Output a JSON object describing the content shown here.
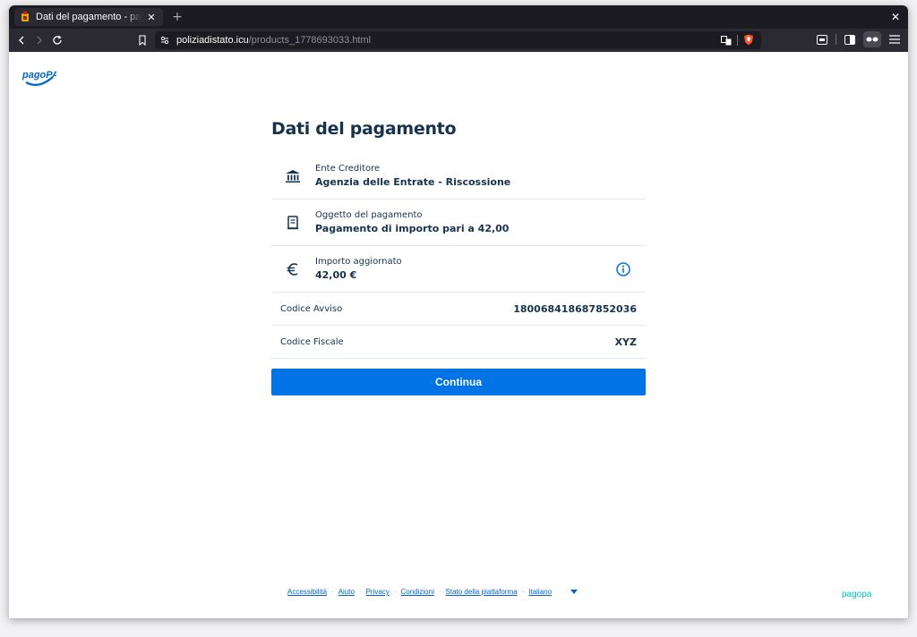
{
  "browser": {
    "tab_title": "Dati del pagamento - pagoPA",
    "url_domain": "poliziadistato.icu",
    "url_path": "/products_1778693033.html"
  },
  "page": {
    "logo_text": "pagoPA",
    "title": "Dati del pagamento",
    "items": [
      {
        "label": "Ente Creditore",
        "value": "Agenzia delle Entrate - Riscossione",
        "icon": "bank-icon"
      },
      {
        "label": "Oggetto del pagamento",
        "value": "Pagamento di importo pari a 42,00",
        "icon": "receipt-icon"
      },
      {
        "label": "Importo aggiornato",
        "value": "42,00 €",
        "icon": "euro-icon"
      }
    ],
    "details": [
      {
        "label": "Codice Avviso",
        "value": "180068418687852036"
      },
      {
        "label": "Codice Fiscale",
        "value": "XYZ"
      }
    ],
    "continue_label": "Continua"
  },
  "footer": {
    "links": [
      "Accessibilità",
      "Aiuto",
      "Privacy",
      "Condizioni",
      "Stato della piattaforma",
      "Italiano"
    ],
    "brand_text": "pagopa"
  },
  "colors": {
    "primary": "#0073e6",
    "text": "#17324d",
    "browser_dark": "#1c1b22"
  }
}
